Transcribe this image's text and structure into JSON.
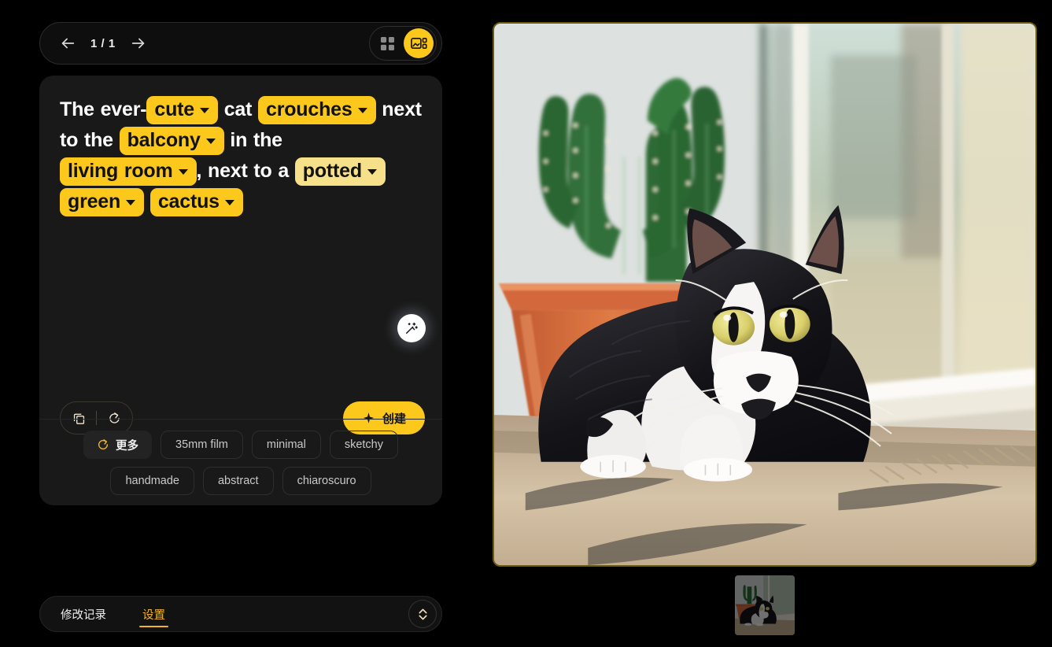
{
  "nav": {
    "back_icon": "arrow-left-icon",
    "forward_icon": "arrow-right-icon",
    "page_indicator": "1 / 1",
    "grid_view_icon": "grid-view-icon",
    "detail_view_icon": "detail-view-icon",
    "active_view": "detail"
  },
  "prompt": {
    "segments": [
      {
        "type": "text",
        "value": "The ever-"
      },
      {
        "type": "chip",
        "value": "cute",
        "variant": "solid"
      },
      {
        "type": "text",
        "value": " cat "
      },
      {
        "type": "chip",
        "value": "crouches",
        "variant": "solid"
      },
      {
        "type": "text",
        "value": " next to the "
      },
      {
        "type": "chip",
        "value": "balcony",
        "variant": "solid"
      },
      {
        "type": "text",
        "value": " in the "
      },
      {
        "type": "chip",
        "value": "living room",
        "variant": "solid"
      },
      {
        "type": "text",
        "value": ", next to a "
      },
      {
        "type": "chip",
        "value": "potted",
        "variant": "light"
      },
      {
        "type": "text",
        "value": " "
      },
      {
        "type": "chip",
        "value": "green",
        "variant": "solid"
      },
      {
        "type": "text",
        "value": " "
      },
      {
        "type": "chip",
        "value": "cactus",
        "variant": "solid"
      }
    ],
    "magic_edit_icon": "magic-wand-icon",
    "copy_icon": "copy-icon",
    "reset_icon": "reset-icon",
    "create_label": "创建",
    "create_icon": "sparkle-icon"
  },
  "styles": {
    "more_label": "更多",
    "more_icon": "refresh-icon",
    "row1": [
      "35mm film",
      "minimal",
      "sketchy"
    ],
    "row2": [
      "handmade",
      "abstract",
      "chiaroscuro"
    ]
  },
  "tabs": {
    "items": [
      {
        "label": "修改记录",
        "active": false
      },
      {
        "label": "设置",
        "active": true
      }
    ],
    "expand_icon": "chevron-updown-icon"
  },
  "image": {
    "alt": "black and white tuxedo cat crouching on a rug by a window next to a potted green cactus",
    "thumbnail_alt": "thumbnail of cat by window"
  },
  "colors": {
    "accent": "#FCC81C",
    "accent_light": "#F7E08A",
    "accent_text": "#F0B429",
    "page_bg": "#000000",
    "card_bg": "#191919",
    "image_border": "#6b5a12"
  }
}
